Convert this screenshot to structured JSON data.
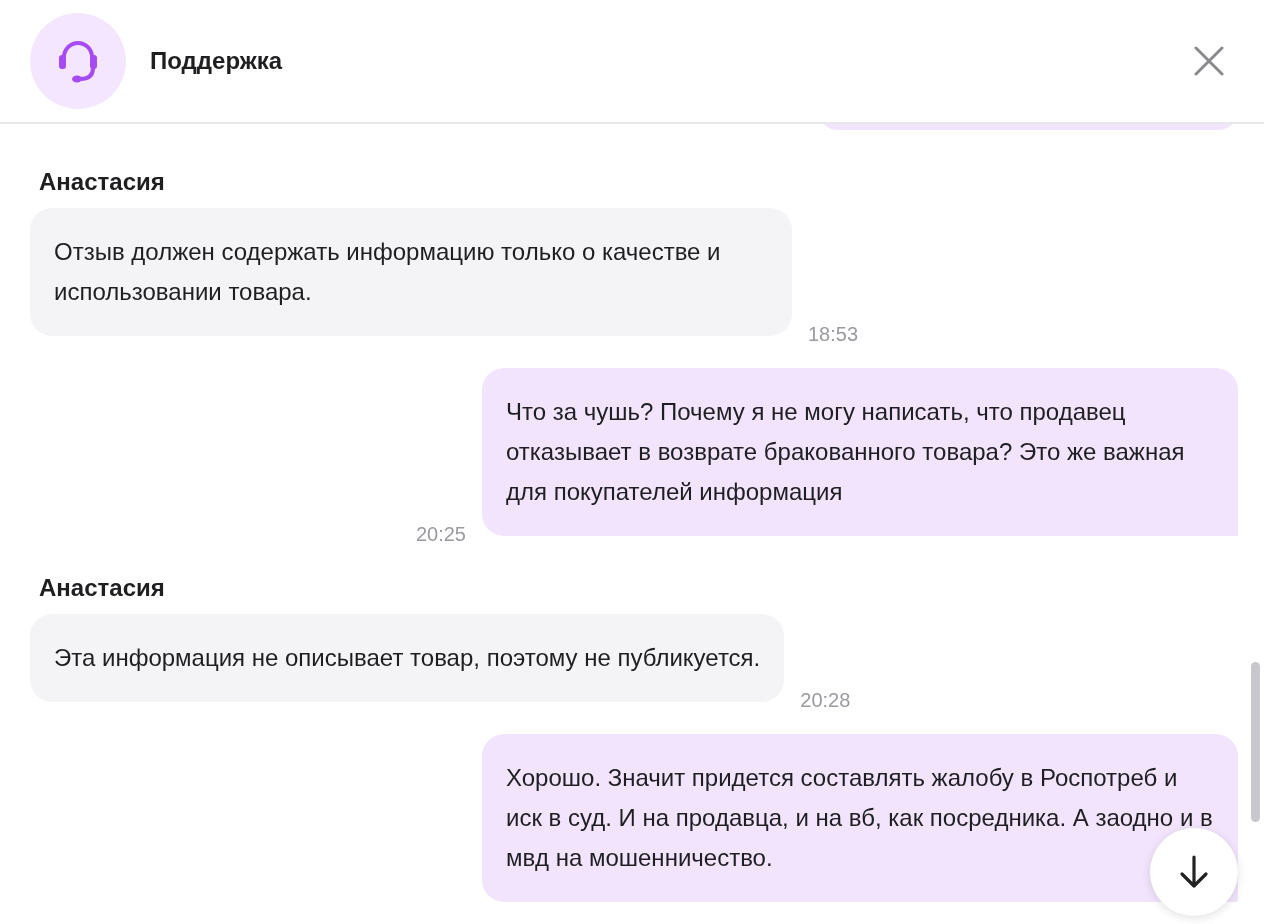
{
  "header": {
    "title": "Поддержка"
  },
  "messages": [
    {
      "kind": "incoming",
      "sender": "Анастасия",
      "text": "Отзыв должен содержать информацию только о качестве и использовании товара.",
      "time": "18:53"
    },
    {
      "kind": "outgoing",
      "text": "Что за чушь? Почему я не могу написать, что продавец отказывает в возврате бракованного товара? Это же важная для покупателей информация",
      "time": "20:25"
    },
    {
      "kind": "incoming",
      "sender": "Анастасия",
      "text": "Эта информация не описывает товар, поэтому не публикуется.",
      "time": "20:28"
    },
    {
      "kind": "outgoing",
      "text": "Хорошо. Значит придется составлять жалобу в Роспотреб и иск в суд. И на продавца, и на вб, как посредника. А заодно и в мвд на мошенничество."
    }
  ]
}
